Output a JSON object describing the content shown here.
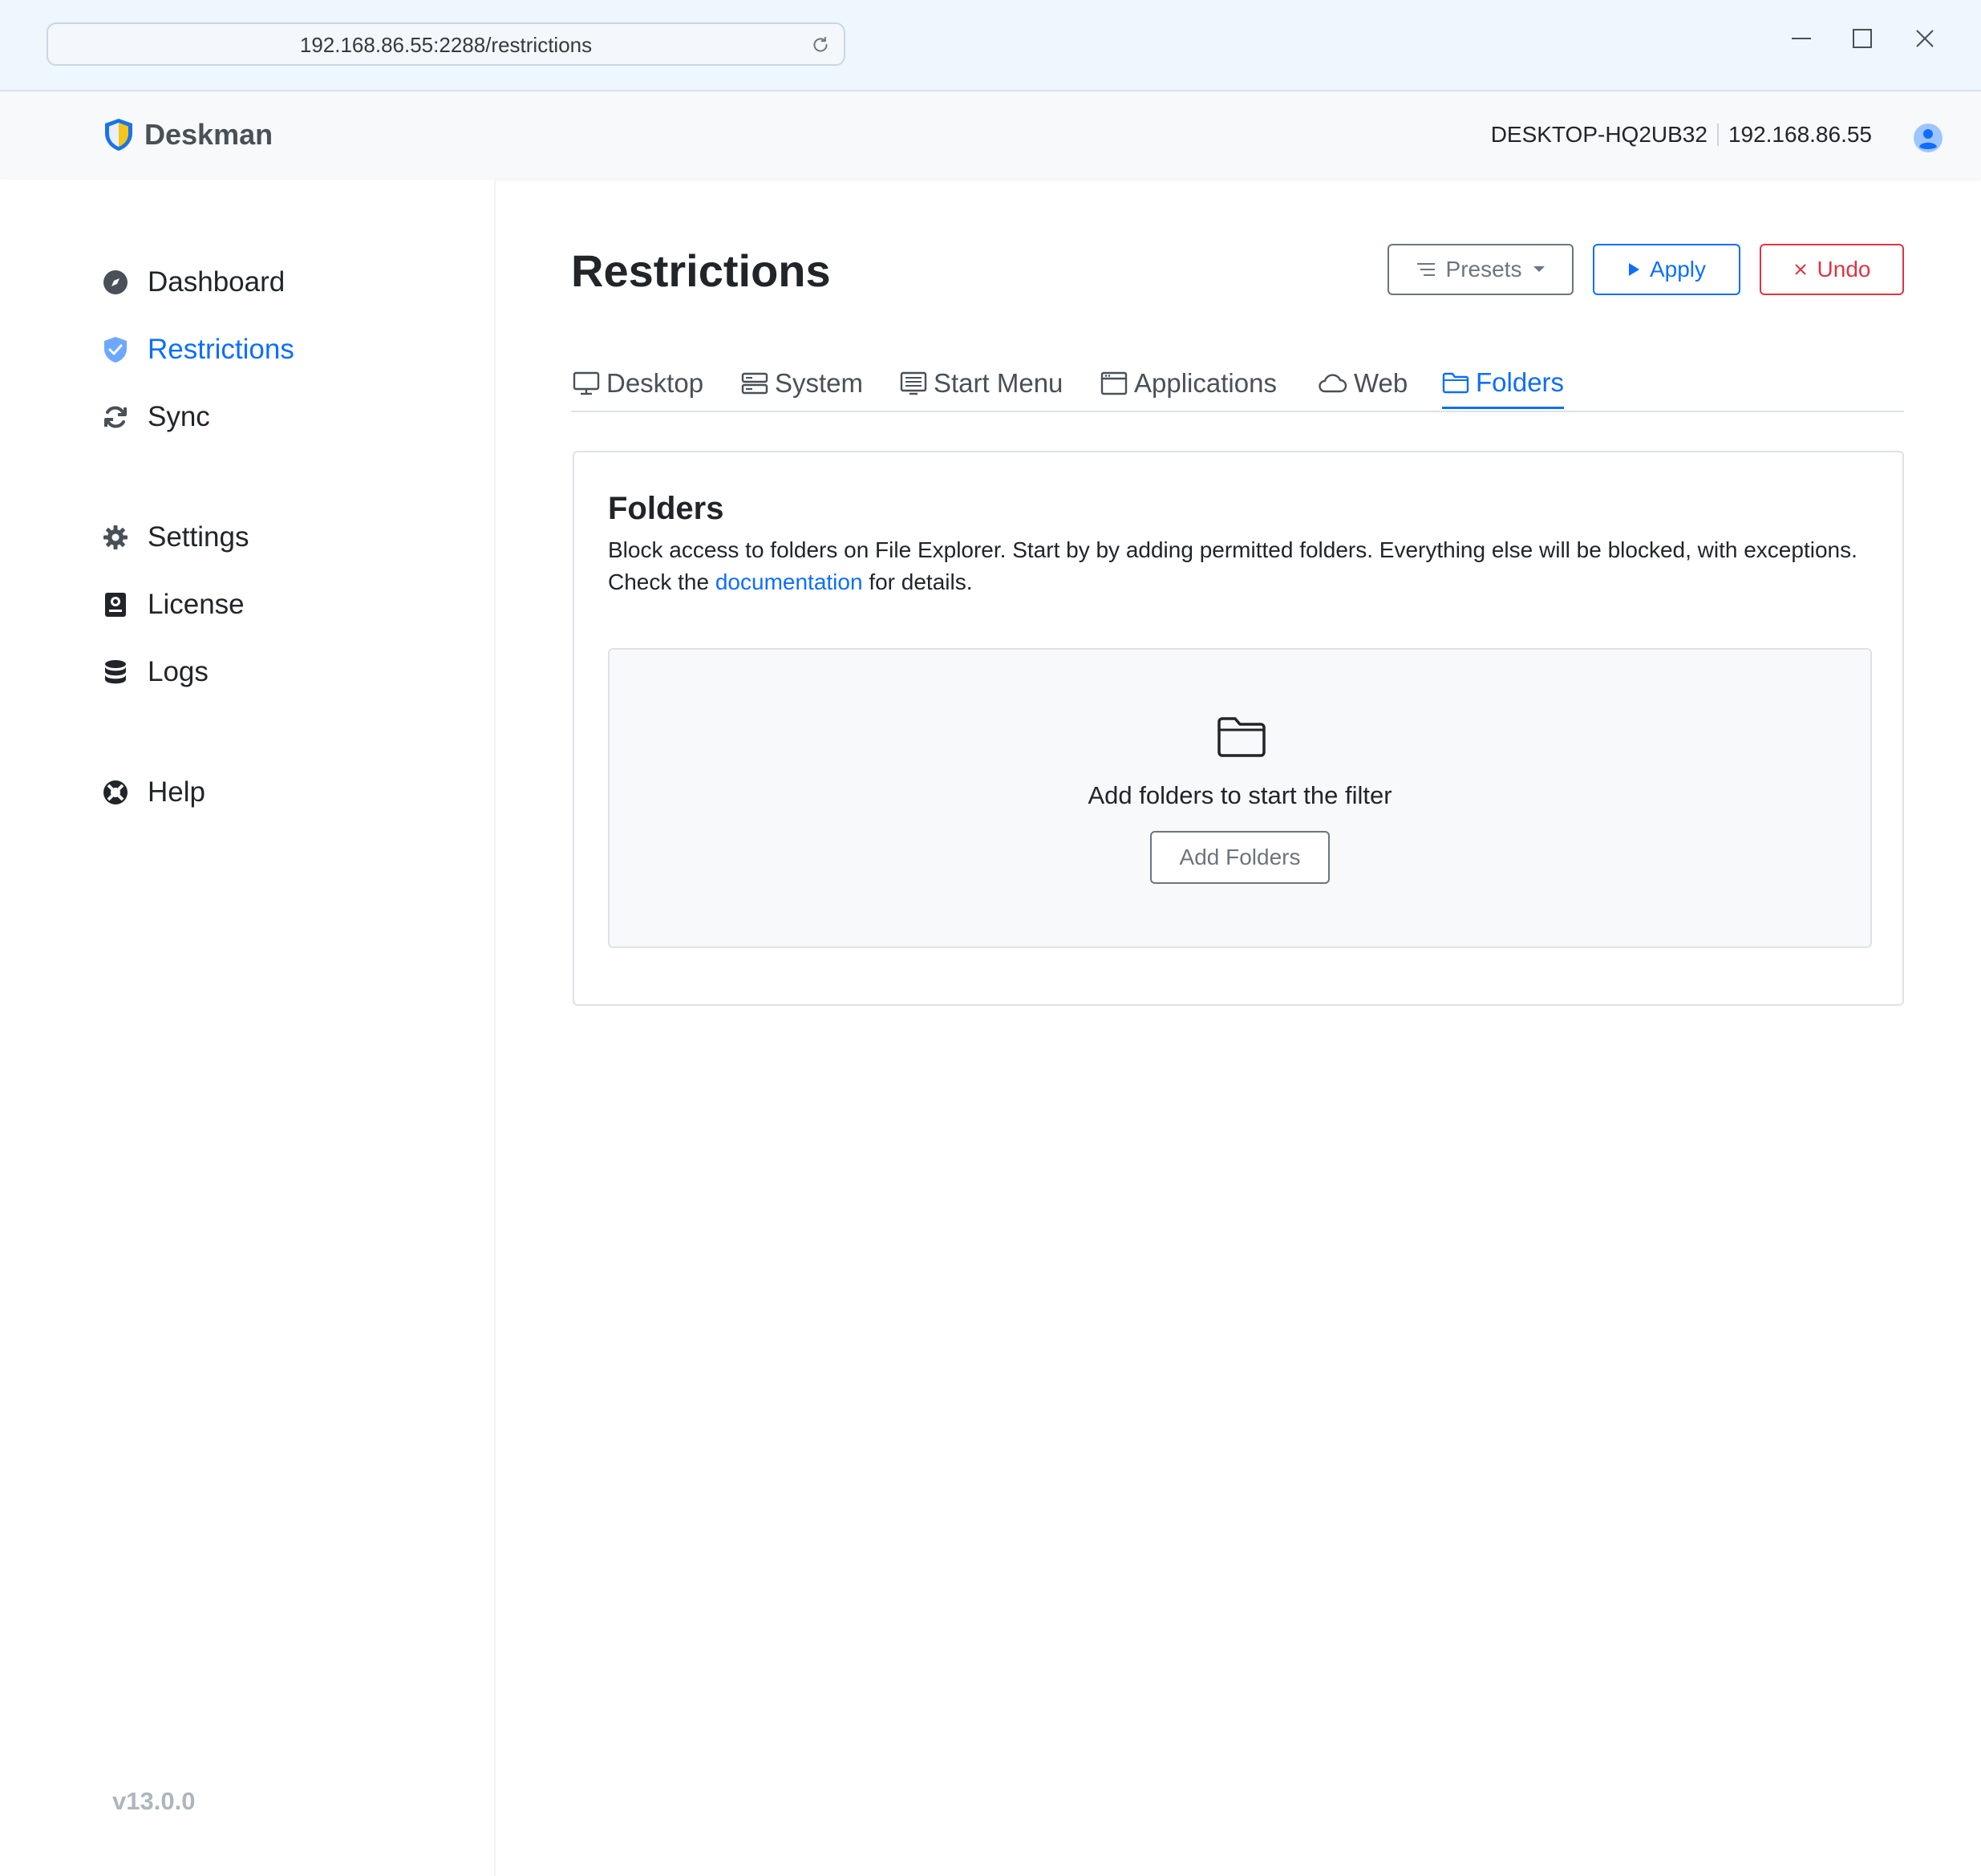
{
  "browser": {
    "url": "192.168.86.55:2288/restrictions"
  },
  "app": {
    "brand": "Deskman",
    "hostname": "DESKTOP-HQ2UB32",
    "ip": "192.168.86.55",
    "version": "v13.0.0"
  },
  "sidebar": {
    "items": [
      {
        "label": "Dashboard",
        "icon": "compass-icon"
      },
      {
        "label": "Restrictions",
        "icon": "shield-check-icon",
        "active": true
      },
      {
        "label": "Sync",
        "icon": "sync-icon"
      },
      {
        "label": "Settings",
        "icon": "gear-icon"
      },
      {
        "label": "License",
        "icon": "license-icon"
      },
      {
        "label": "Logs",
        "icon": "database-icon"
      },
      {
        "label": "Help",
        "icon": "lifebuoy-icon"
      }
    ]
  },
  "page": {
    "title": "Restrictions",
    "presets_label": "Presets",
    "apply_label": "Apply",
    "undo_label": "Undo"
  },
  "tabs": [
    {
      "label": "Desktop",
      "icon": "monitor-icon"
    },
    {
      "label": "System",
      "icon": "server-icon"
    },
    {
      "label": "Start Menu",
      "icon": "start-menu-icon"
    },
    {
      "label": "Applications",
      "icon": "window-icon"
    },
    {
      "label": "Web",
      "icon": "cloud-icon"
    },
    {
      "label": "Folders",
      "icon": "folder-icon",
      "active": true
    }
  ],
  "folders": {
    "title": "Folders",
    "desc_before": "Block access to folders on File Explorer. Start by by adding permitted folders. Everything else will be blocked, with exceptions. Check the ",
    "desc_link": "documentation",
    "desc_after": " for details.",
    "empty_text": "Add folders to start the filter",
    "add_button": "Add Folders"
  },
  "colors": {
    "accent": "#0d6efd",
    "danger": "#dc3545",
    "secondary": "#6c757d"
  }
}
